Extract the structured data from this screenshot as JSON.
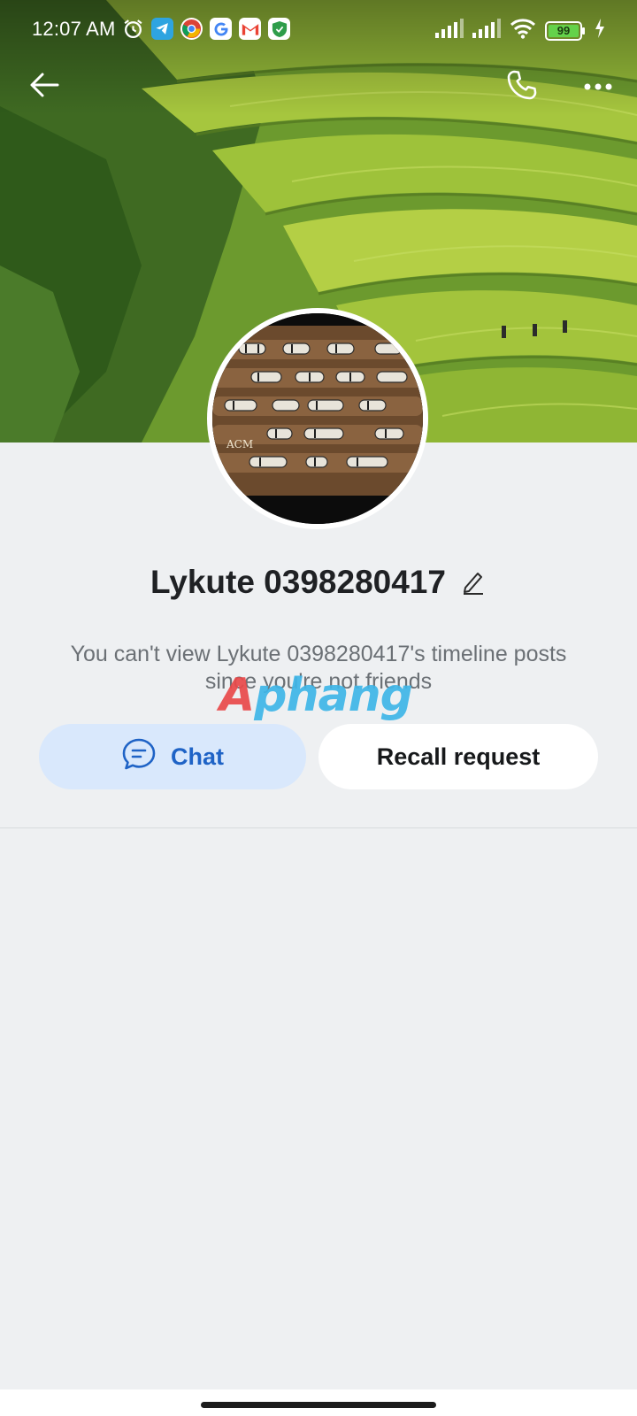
{
  "status_bar": {
    "time": "12:07 AM",
    "battery": "99",
    "left_icons": [
      "alarm-icon",
      "telegram-icon",
      "chrome-icon",
      "google-icon",
      "gmail-icon",
      "shield-app-icon"
    ],
    "right_icons": [
      "signal-icon",
      "signal-icon",
      "wifi-icon",
      "battery-icon",
      "charging-icon"
    ]
  },
  "nav": {
    "back_icon": "back-arrow-icon",
    "call_icon": "phone-icon",
    "more_icon": "more-icon"
  },
  "profile": {
    "name": "Lykute 0398280417",
    "edit_icon": "pencil-icon",
    "avatar_text": "ACM",
    "info": "You can't view Lykute 0398280417's timeline posts since you're not friends"
  },
  "actions": {
    "chat_label": "Chat",
    "chat_icon": "chat-bubble-icon",
    "recall_label": "Recall request"
  },
  "watermark": {
    "first": "A",
    "rest": "phang"
  },
  "colors": {
    "page_bg": "#eef0f2",
    "chat_bg": "#d9e8fc",
    "chat_text": "#1f63c6",
    "recall_bg": "#ffffff",
    "battery_fill": "#64d24a"
  }
}
